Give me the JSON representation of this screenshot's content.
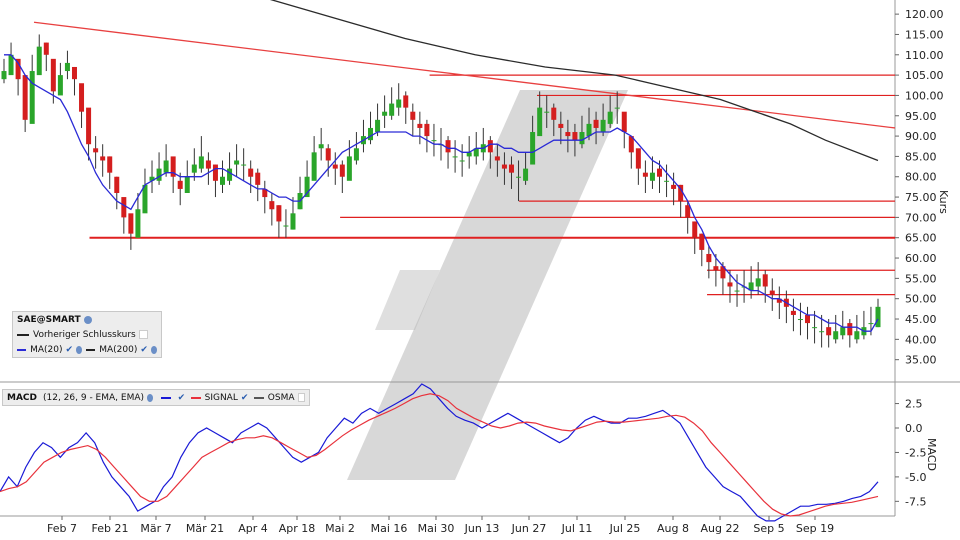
{
  "chart_data": [
    {
      "type": "candlestick",
      "symbol": "SAE@SMART",
      "ylabel": "Kurs",
      "ylim": [
        30,
        122
      ],
      "yticks": [
        "120.00",
        "115.00",
        "110.00",
        "105.00",
        "100.00",
        "95.00",
        "90.00",
        "85.00",
        "80.00",
        "75.00",
        "70.00",
        "65.00",
        "60.00",
        "55.00",
        "50.00",
        "45.00",
        "40.00",
        "35.00"
      ],
      "x_dates": [
        "Feb 7",
        "Feb 21",
        "Mär 7",
        "Mär 21",
        "Apr 4",
        "Apr 18",
        "Mai 2",
        "Mai 16",
        "Mai 30",
        "Jun 13",
        "Jun 27",
        "Jul 11",
        "Jul 25",
        "Aug 8",
        "Aug 22",
        "Sep 5",
        "Sep 19"
      ],
      "legend": {
        "title": "SAE@SMART",
        "items": [
          "Vorheriger Schlusskurs",
          "MA(20)",
          "MA(200)"
        ]
      },
      "close_series": [
        106,
        110,
        104,
        94,
        106,
        112,
        110,
        101,
        105,
        108,
        104,
        96,
        88,
        86,
        84,
        81,
        76,
        70,
        66,
        72,
        78,
        80,
        82,
        84,
        80,
        77,
        80,
        83,
        85,
        82,
        79,
        80,
        82,
        84,
        83,
        80,
        78,
        75,
        72,
        69,
        68,
        71,
        76,
        80,
        86,
        88,
        84,
        82,
        80,
        85,
        87,
        90,
        92,
        94,
        96,
        98,
        99,
        97,
        94,
        92,
        90,
        89,
        88,
        86,
        85,
        84,
        86,
        87,
        88,
        86,
        84,
        82,
        81,
        80,
        82,
        91,
        97,
        96,
        94,
        92,
        90,
        89,
        91,
        93,
        92,
        94,
        96,
        97,
        91,
        86,
        82,
        80,
        81,
        80,
        79,
        77,
        74,
        70,
        65,
        62,
        59,
        57,
        55,
        53,
        52,
        53,
        54,
        55,
        53,
        51,
        49,
        48,
        46,
        45,
        44,
        43,
        42,
        41,
        42,
        43,
        41,
        42,
        43,
        44,
        48
      ],
      "high_series": [
        109,
        113,
        108,
        98,
        110,
        115,
        113,
        105,
        108,
        111,
        107,
        100,
        92,
        90,
        88,
        85,
        80,
        74,
        70,
        76,
        82,
        84,
        86,
        88,
        84,
        81,
        84,
        87,
        90,
        86,
        83,
        84,
        86,
        88,
        87,
        84,
        82,
        79,
        76,
        73,
        72,
        75,
        80,
        84,
        90,
        92,
        88,
        86,
        84,
        89,
        91,
        94,
        96,
        98,
        100,
        102,
        103,
        101,
        98,
        96,
        94,
        93,
        92,
        90,
        89,
        88,
        90,
        91,
        92,
        90,
        88,
        86,
        85,
        84,
        86,
        95,
        101,
        100,
        98,
        96,
        94,
        93,
        95,
        97,
        96,
        98,
        100,
        101,
        95,
        90,
        86,
        84,
        85,
        84,
        83,
        81,
        78,
        74,
        69,
        66,
        63,
        61,
        59,
        57,
        56,
        57,
        58,
        59,
        57,
        55,
        53,
        52,
        50,
        49,
        48,
        47,
        46,
        45,
        46,
        47,
        45,
        46,
        47,
        48,
        50
      ],
      "low_series": [
        103,
        106,
        100,
        91,
        102,
        108,
        106,
        98,
        101,
        104,
        100,
        92,
        84,
        82,
        80,
        77,
        72,
        66,
        62,
        68,
        74,
        76,
        78,
        80,
        76,
        73,
        76,
        79,
        81,
        78,
        75,
        76,
        78,
        80,
        79,
        76,
        74,
        71,
        68,
        65,
        65,
        67,
        72,
        76,
        82,
        84,
        80,
        78,
        76,
        81,
        83,
        86,
        88,
        90,
        92,
        94,
        95,
        93,
        90,
        88,
        86,
        85,
        84,
        82,
        81,
        80,
        82,
        83,
        84,
        82,
        80,
        78,
        77,
        74,
        78,
        87,
        93,
        92,
        90,
        88,
        86,
        85,
        87,
        89,
        88,
        90,
        92,
        93,
        87,
        82,
        78,
        76,
        77,
        76,
        75,
        73,
        70,
        66,
        61,
        58,
        55,
        53,
        51,
        49,
        48,
        49,
        50,
        51,
        49,
        47,
        45,
        44,
        42,
        41,
        40,
        39,
        38,
        38,
        39,
        40,
        38,
        39,
        40,
        41,
        43
      ],
      "ma20": [
        110,
        110,
        108,
        105,
        103,
        102,
        101,
        100,
        99,
        96,
        92,
        88,
        85,
        81,
        78,
        76,
        74,
        73,
        72,
        75,
        78,
        79,
        80,
        81,
        81,
        80,
        80,
        80,
        80,
        81,
        82,
        82,
        81,
        80,
        79,
        78,
        77,
        77,
        76,
        75,
        75,
        74,
        74,
        76,
        78,
        80,
        82,
        84,
        86,
        87,
        88,
        89,
        90,
        91,
        91,
        91,
        91,
        91,
        90,
        90,
        89,
        88,
        88,
        87,
        87,
        86,
        86,
        87,
        87,
        88,
        88,
        87,
        87,
        86,
        86,
        86,
        87,
        88,
        89,
        89,
        89,
        89,
        89,
        90,
        91,
        91,
        91,
        92,
        91,
        90,
        88,
        86,
        84,
        83,
        81,
        79,
        77,
        74,
        70,
        67,
        63,
        60,
        58,
        56,
        54,
        53,
        52,
        52,
        51,
        50,
        50,
        49,
        48,
        47,
        46,
        46,
        45,
        44,
        44,
        43,
        43,
        43,
        42,
        42,
        45
      ],
      "ma200": [
        null,
        null,
        null,
        null,
        null,
        null,
        null,
        null,
        null,
        null,
        null,
        null,
        null,
        null,
        null,
        null,
        null,
        null,
        null,
        null,
        null,
        null,
        null,
        null,
        null,
        null,
        null,
        null,
        null,
        null,
        null,
        null,
        null,
        null,
        null,
        null,
        null,
        null,
        null,
        null,
        null,
        null,
        null,
        null,
        null,
        null,
        null,
        null,
        null,
        null,
        null,
        null,
        null,
        null,
        null,
        null,
        null,
        null,
        null,
        null,
        null,
        null,
        null,
        null,
        null,
        null,
        null,
        null,
        null,
        null,
        null,
        null,
        null,
        null,
        null,
        null,
        null,
        null,
        null,
        null,
        null,
        null,
        null,
        null,
        null,
        null,
        null,
        null,
        null,
        null,
        null,
        null,
        null,
        null,
        null,
        null,
        null,
        null,
        null,
        null,
        null,
        null,
        null,
        null,
        null,
        null,
        null,
        null,
        null,
        null,
        null,
        null,
        null,
        null,
        null,
        null,
        null,
        null,
        null,
        null,
        null,
        null,
        null,
        null,
        null
      ],
      "ma200_points": [
        [
          0,
          124
        ],
        [
          20,
          119
        ],
        [
          40,
          114
        ],
        [
          60,
          110
        ],
        [
          80,
          107
        ],
        [
          100,
          105
        ],
        [
          110,
          103
        ],
        [
          120,
          101
        ],
        [
          130,
          99
        ],
        [
          140,
          96
        ],
        [
          150,
          93
        ],
        [
          160,
          89
        ],
        [
          175,
          84
        ]
      ],
      "trendline": [
        [
          0,
          118
        ],
        [
          178,
          92
        ]
      ],
      "support_levels": [
        {
          "value": 65,
          "from": 0.1
        },
        {
          "value": 70,
          "from": 0.38
        },
        {
          "value": 74,
          "from": 0.58
        },
        {
          "value": 105,
          "from": 0.48
        },
        {
          "value": 100,
          "from": 0.6
        },
        {
          "value": 57,
          "from": 0.79
        },
        {
          "value": 51,
          "from": 0.79
        }
      ]
    },
    {
      "type": "line",
      "title": "MACD",
      "params": "(12, 26, 9 - EMA, EMA)",
      "legend": [
        "SIGNAL",
        "OSMA"
      ],
      "ylabel": "MACD",
      "ylim": [
        -9,
        4.5
      ],
      "yticks": [
        "2.5",
        "0.0",
        "-2.5",
        "-5.0",
        "-7.5"
      ],
      "series": [
        {
          "name": "MACD",
          "color": "#1a1ad6",
          "values": [
            -6.5,
            -5,
            -6,
            -4,
            -2.5,
            -1.5,
            -2,
            -3,
            -2,
            -1.5,
            -0.5,
            -1.5,
            -3.5,
            -5,
            -6,
            -7,
            -8.5,
            -8,
            -7.5,
            -6,
            -5,
            -3,
            -1.5,
            -0.5,
            0,
            -0.5,
            -1,
            -1.5,
            -0.5,
            0,
            0.5,
            0,
            -1,
            -2,
            -3,
            -3.5,
            -3,
            -2.5,
            -1,
            0,
            1,
            0.5,
            1.5,
            2,
            1.5,
            2,
            2.5,
            3,
            3.5,
            4.5,
            4,
            3,
            2,
            1.2,
            0.8,
            0.5,
            0,
            0.5,
            1,
            1.5,
            1,
            0.5,
            0,
            -0.5,
            -1,
            -1.5,
            -1,
            0,
            0.8,
            1.2,
            0.8,
            0.5,
            0.5,
            1,
            1,
            1.2,
            1.5,
            1.8,
            1.2,
            0.5,
            -1,
            -2.5,
            -4,
            -5,
            -6,
            -6.5,
            -7,
            -8,
            -9,
            -9.5,
            -9.5,
            -9,
            -8.5,
            -8,
            -8,
            -7.8,
            -7.8,
            -7.7,
            -7.5,
            -7.2,
            -7,
            -6.5,
            -5.5
          ]
        },
        {
          "name": "SIGNAL",
          "color": "#e8323c",
          "values": [
            -6.5,
            -6.2,
            -6,
            -5.5,
            -4.5,
            -3.5,
            -3,
            -2.5,
            -2.2,
            -2,
            -1.8,
            -2.2,
            -3,
            -4,
            -5,
            -6,
            -7,
            -7.5,
            -7.5,
            -7,
            -6,
            -5,
            -4,
            -3,
            -2.5,
            -2,
            -1.5,
            -1.2,
            -1,
            -1,
            -0.8,
            -1,
            -1.5,
            -2,
            -2.5,
            -3,
            -2.8,
            -2.2,
            -1.5,
            -0.8,
            -0.2,
            0.3,
            0.8,
            1.2,
            1.6,
            2,
            2.5,
            3,
            3.3,
            3.5,
            3.3,
            2.8,
            2,
            1.5,
            1,
            0.6,
            0.2,
            0,
            0.2,
            0.5,
            0.6,
            0.5,
            0.2,
            0,
            -0.2,
            -0.3,
            0,
            0.3,
            0.6,
            0.7,
            0.6,
            0.6,
            0.7,
            0.8,
            0.9,
            1,
            1.2,
            1.3,
            1.1,
            0.5,
            -0.3,
            -1.5,
            -2.5,
            -3.5,
            -4.5,
            -5.5,
            -6.5,
            -7.5,
            -8.3,
            -8.8,
            -9,
            -8.9,
            -8.6,
            -8.3,
            -8,
            -7.8,
            -7.7,
            -7.6,
            -7.4,
            -7.2,
            -7
          ]
        }
      ]
    }
  ],
  "legend_labels": {
    "symbol": "SAE@SMART",
    "prev_close": "Vorheriger Schlusskurs",
    "ma20": "MA(20)",
    "ma200": "MA(200)",
    "macd_title": "MACD",
    "macd_params": "(12, 26, 9 - EMA, EMA)",
    "signal": "SIGNAL",
    "osma": "OSMA"
  },
  "colors": {
    "up": "#2aa52a",
    "down": "#d41e1e",
    "ma20": "#2a2ad6",
    "ma200": "#2b2b2b",
    "support": "#e02020",
    "trend": "#e84040",
    "watermark": "#b8b8b8"
  }
}
